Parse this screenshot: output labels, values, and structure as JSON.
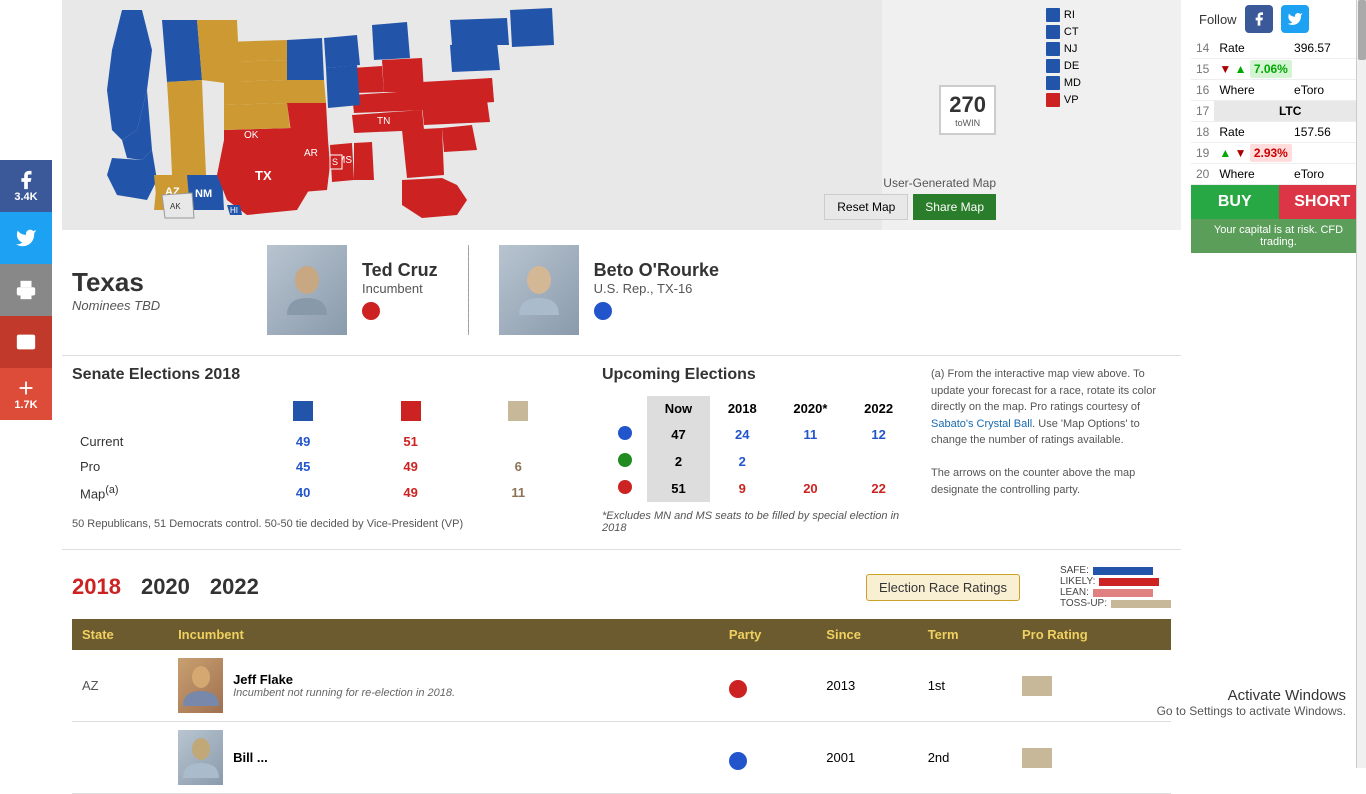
{
  "social": {
    "facebook_count": "3.4K",
    "facebook_label": "Facebook",
    "twitter_label": "Twitter",
    "print_label": "Print",
    "email_label": "Email",
    "plus_label": "1.7K"
  },
  "map": {
    "title": "User-Generated Map",
    "reset_label": "Reset Map",
    "share_label": "Share Map",
    "win_number": "270",
    "win_sub": "toWIN",
    "follow_label": "Follow"
  },
  "legend": {
    "items": [
      {
        "label": "RI",
        "color": "#2255aa"
      },
      {
        "label": "CT",
        "color": "#2255aa"
      },
      {
        "label": "NJ",
        "color": "#2255aa"
      },
      {
        "label": "DE",
        "color": "#2255aa"
      },
      {
        "label": "MD",
        "color": "#2255aa"
      },
      {
        "label": "VP",
        "color": "#cc2222"
      }
    ]
  },
  "crypto": {
    "header": "LTC",
    "rows": [
      {
        "num": 14,
        "label": "Rate",
        "value": "396.57"
      },
      {
        "num": 15,
        "label": "",
        "pct": "7.06%",
        "direction": "up"
      },
      {
        "num": 16,
        "label": "Where",
        "value": "eToro"
      },
      {
        "num": 17,
        "label": "LTC",
        "header": true
      },
      {
        "num": 18,
        "label": "Rate",
        "value": "157.56"
      },
      {
        "num": 19,
        "label": "",
        "pct": "2.93%",
        "direction": "down"
      },
      {
        "num": 20,
        "label": "Where",
        "value": "eToro"
      }
    ],
    "buy_label": "BUY",
    "short_label": "SHORT",
    "risk_warning": "Your capital is at risk. CFD trading."
  },
  "texas": {
    "state_name": "Texas",
    "nominees_tbd": "Nominees TBD",
    "candidate1": {
      "name": "Ted Cruz",
      "title": "Incumbent",
      "party": "red"
    },
    "candidate2": {
      "name": "Beto O'Rourke",
      "title": "U.S. Rep., TX-16",
      "party": "blue"
    }
  },
  "senate_elections": {
    "title": "Senate Elections 2018",
    "headers": [
      "",
      "Blue",
      "Red",
      "Tan"
    ],
    "rows": [
      {
        "label": "Current",
        "blue": "49",
        "red": "51",
        "tan": ""
      },
      {
        "label": "Pro",
        "blue": "45",
        "red": "49",
        "tan": "6"
      },
      {
        "label": "Map(a)",
        "blue": "40",
        "red": "49",
        "tan": "11"
      }
    ],
    "footnote": "50 Republicans, 51 Democrats control. 50-50 tie decided by Vice-President (VP)"
  },
  "upcoming_elections": {
    "title": "Upcoming Elections",
    "columns": [
      "Now",
      "2018",
      "2020*",
      "2022"
    ],
    "rows": [
      {
        "dot": "blue",
        "now": "47",
        "y2018": "24",
        "y2020": "11",
        "y2022": "12"
      },
      {
        "dot": "green",
        "now": "2",
        "y2018": "2",
        "y2020": "",
        "y2022": ""
      },
      {
        "dot": "red",
        "now": "51",
        "y2018": "9",
        "y2020": "20",
        "y2022": "22"
      }
    ],
    "footnote": "*Excludes MN and MS seats to be filled by special election in 2018"
  },
  "pro_ratings_note": "(a) From the interactive map view above. To update your forecast for a race, rotate its color directly on the map. Pro ratings courtesy of Sabato's Crystal Ball. Use 'Map Options' to change the number of ratings available.\n\nThe arrows on the counter above the map designate the controlling party.",
  "years": {
    "options": [
      "2018",
      "2020",
      "2022"
    ],
    "active": "2018"
  },
  "ratings_banner": {
    "label": "Election Race Ratings",
    "legend_labels": [
      "SAFE:",
      "LIKELY:",
      "LEAN:",
      "TOSS-UP:"
    ]
  },
  "senators_table": {
    "headers": [
      "State",
      "Incumbent",
      "Party",
      "Since",
      "Term",
      "Pro Rating"
    ],
    "rows": [
      {
        "state": "AZ",
        "incumbent_name": "Jeff Flake",
        "party": "red",
        "since": "2013",
        "term": "1st",
        "pro_rating": "tan",
        "note": "Incumbent not running for re-election in 2018."
      },
      {
        "state": "",
        "incumbent_name": "Bill ...",
        "party": "blue",
        "since": "2001",
        "term": "2nd",
        "pro_rating": "tan",
        "note": ""
      }
    ]
  },
  "activate_windows": {
    "title": "Activate Windows",
    "subtitle": "Go to Settings to activate Windows."
  }
}
